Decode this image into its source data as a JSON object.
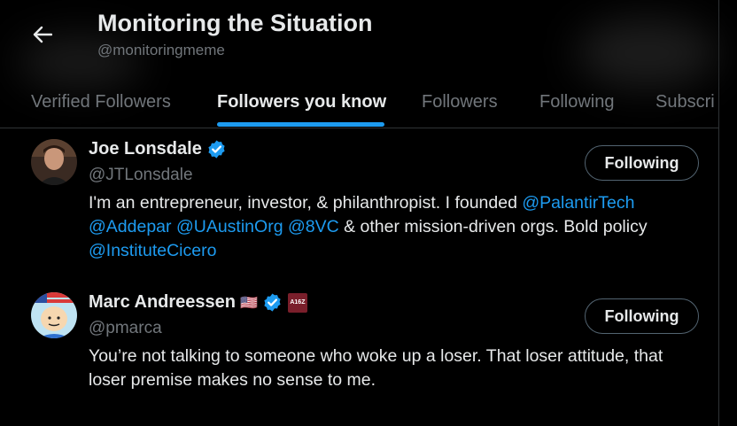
{
  "header": {
    "title": "Monitoring the Situation",
    "handle": "@monitoringmeme",
    "back_icon": "arrow-left-icon"
  },
  "tabs": [
    {
      "label": "Verified Followers",
      "active": false
    },
    {
      "label": "Followers you know",
      "active": true
    },
    {
      "label": "Followers",
      "active": false
    },
    {
      "label": "Following",
      "active": false
    },
    {
      "label": "Subscri",
      "active": false
    }
  ],
  "users": [
    {
      "name": "Joe Lonsdale",
      "handle": "@JTLonsdale",
      "verified": true,
      "follow_label": "Following",
      "bio": {
        "line1_text": "I'm an entrepreneur, investor, & philanthropist. I founded ",
        "line1_mention": "@PalantirTech",
        "line2_m1": "@Addepar",
        "line2_m2": "@UAustinOrg",
        "line2_m3": "@8VC",
        "line2_text": " & other mission-driven orgs. Bold policy",
        "line3_mention": "@InstituteCicero"
      }
    },
    {
      "name": "Marc Andreessen",
      "handle": "@pmarca",
      "verified": true,
      "flag": "🇺🇸",
      "affiliate_badge": "A16Z",
      "follow_label": "Following",
      "bio": {
        "line1": "You’re not talking to someone who woke up a loser. That loser attitude, that",
        "line2": "loser premise makes no sense to me."
      }
    }
  ],
  "colors": {
    "background": "#000000",
    "text": "#e7e9ea",
    "muted": "#71767b",
    "accent": "#1d9bf0",
    "border": "#2f3336"
  }
}
